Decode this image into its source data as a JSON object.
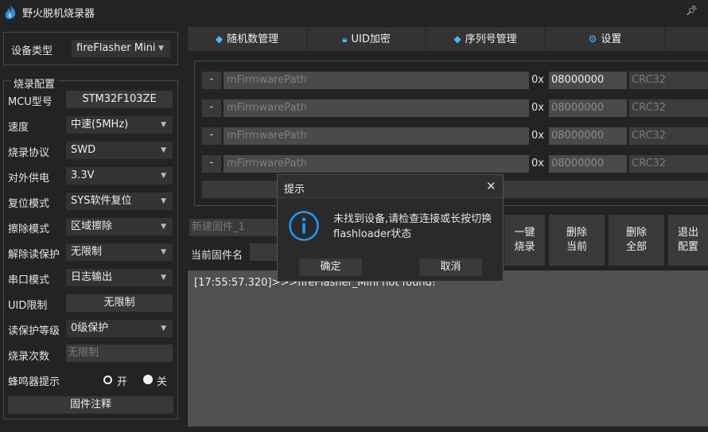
{
  "app": {
    "title": "野火脱机烧录器"
  },
  "device": {
    "label": "设备类型",
    "value": "fireFlasher  Mini"
  },
  "config": {
    "group_title": "烧录配置",
    "mcu_label": "MCU型号",
    "mcu_value": "STM32F103ZE",
    "speed_label": "速度",
    "speed_value": "中速(5MHz)",
    "protocol_label": "烧录协议",
    "protocol_value": "SWD",
    "power_label": "对外供电",
    "power_value": "3.3V",
    "reset_label": "复位模式",
    "reset_value": "SYS软件复位",
    "erase_label": "擦除模式",
    "erase_value": "区域擦除",
    "unprotect_label": "解除读保护",
    "unprotect_value": "无限制",
    "serial_label": "串口模式",
    "serial_value": "日志输出",
    "uid_label": "UID限制",
    "uid_value": "无限制",
    "rdp_label": "读保护等级",
    "rdp_value": "0级保护",
    "count_label": "烧录次数",
    "count_placeholder": "无限制",
    "buzzer_label": "蜂鸣器提示",
    "buzzer_on": "开",
    "buzzer_off": "关",
    "buzzer_selected": "关",
    "notes_button": "固件注释"
  },
  "tabs": [
    {
      "label": "随机数管理",
      "icon": "eraser-icon"
    },
    {
      "label": "UID加密",
      "icon": "lock-icon"
    },
    {
      "label": "序列号管理",
      "icon": "eraser-icon"
    },
    {
      "label": "设置",
      "icon": "gear-icon"
    }
  ],
  "firmware_rows": [
    {
      "minus": "-",
      "path": "mFirmwarePath",
      "prefix": "0x",
      "address": "08000000",
      "crc": "CRC32",
      "active": true
    },
    {
      "minus": "-",
      "path": "mFirmwarePath",
      "prefix": "0x",
      "address": "08000000",
      "crc": "CRC32",
      "active": false
    },
    {
      "minus": "-",
      "path": "mFirmwarePath",
      "prefix": "0x",
      "address": "08000000",
      "crc": "CRC32",
      "active": false
    },
    {
      "minus": "-",
      "path": "mFirmwarePath",
      "prefix": "0x",
      "address": "08000000",
      "crc": "CRC32",
      "active": false
    }
  ],
  "firmware": {
    "new_name_placeholder": "新建固件_1",
    "current_label": "当前固件名"
  },
  "actions": {
    "burn": [
      "一键",
      "烧录"
    ],
    "delete_current": [
      "删除",
      "当前"
    ],
    "delete_all": [
      "删除",
      "全部"
    ],
    "exit_config": [
      "退出",
      "配置"
    ]
  },
  "log": {
    "line": "[17:55:57.320]>>>fireFlasher_Mini not found!"
  },
  "dialog": {
    "title": "提示",
    "message_line1": "未找到设备,请检查连接或长按切换",
    "message_line2": "flashloader状态",
    "ok": "确定",
    "cancel": "取消"
  },
  "colors": {
    "accent": "#4fb3ff",
    "background": "#232323",
    "dialog_icon": "#1e9bff"
  }
}
